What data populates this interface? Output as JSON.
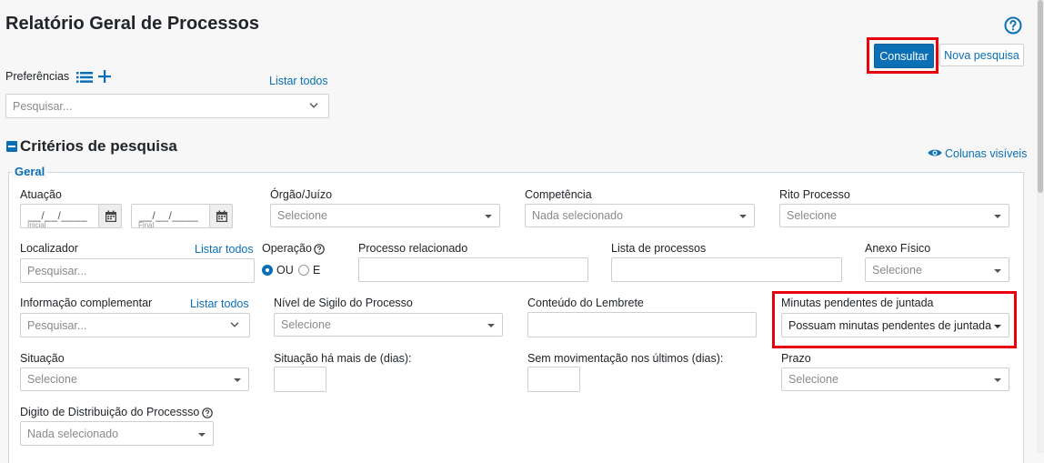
{
  "page": {
    "title": "Relatório Geral de Processos"
  },
  "toolbar": {
    "consultar": "Consultar",
    "nova_pesquisa": "Nova pesquisa"
  },
  "preferencias": {
    "label": "Preferências",
    "listar_todos": "Listar todos",
    "search_placeholder": "Pesquisar..."
  },
  "criterios": {
    "title": "Critérios de pesquisa",
    "colunas_visiveis": "Colunas visíveis"
  },
  "geral": {
    "legend": "Geral",
    "atuacao": {
      "label": "Atuação",
      "inicial_mask": "__/__/____",
      "inicial_sub": "Inicial",
      "final_mask": "__/__/____",
      "final_sub": "Final"
    },
    "orgao": {
      "label": "Órgão/Juízo",
      "placeholder": "Selecione"
    },
    "competencia": {
      "label": "Competência",
      "placeholder": "Nada selecionado"
    },
    "rito": {
      "label": "Rito Processo",
      "placeholder": "Selecione"
    },
    "localizador": {
      "label": "Localizador",
      "listar_todos": "Listar todos",
      "placeholder": "Pesquisar..."
    },
    "operacao": {
      "label": "Operação",
      "opt_ou": "OU",
      "opt_e": "E"
    },
    "processo_relacionado": {
      "label": "Processo relacionado"
    },
    "lista_processos": {
      "label": "Lista de processos"
    },
    "anexo_fisico": {
      "label": "Anexo Físico",
      "placeholder": "Selecione"
    },
    "info_complementar": {
      "label": "Informação complementar",
      "listar_todos": "Listar todos",
      "placeholder": "Pesquisar..."
    },
    "nivel_sigilo": {
      "label": "Nível de Sigilo do Processo",
      "placeholder": "Selecione"
    },
    "conteudo_lembrete": {
      "label": "Conteúdo do Lembrete"
    },
    "minutas": {
      "label": "Minutas pendentes de juntada",
      "value": "Possuam minutas pendentes de juntada"
    },
    "situacao": {
      "label": "Situação",
      "placeholder": "Selecione"
    },
    "situacao_dias": {
      "label": "Situação há mais de (dias):"
    },
    "sem_movimentacao": {
      "label": "Sem movimentação nos últimos (dias):"
    },
    "prazo": {
      "label": "Prazo",
      "placeholder": "Selecione"
    },
    "digito": {
      "label": "Digito de Distribuição do Processso",
      "placeholder": "Nada selecionado"
    }
  },
  "colors": {
    "accent": "#0a6fb5",
    "highlight": "#e8000c"
  }
}
